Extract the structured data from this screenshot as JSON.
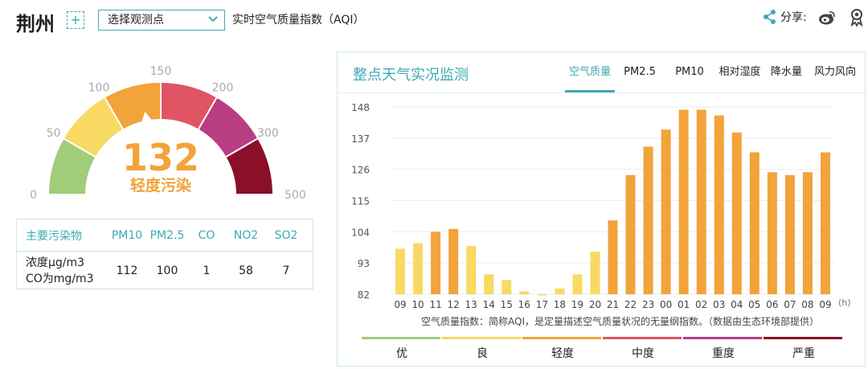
{
  "header": {
    "city": "荆州",
    "add_label": "+",
    "station_select": "选择观测点",
    "aqi_title": "实时空气质量指数（AQI）",
    "share_label": "分享:"
  },
  "gauge": {
    "value": "132",
    "level": "轻度污染",
    "ticks": [
      "0",
      "50",
      "100",
      "150",
      "200",
      "300",
      "500"
    ],
    "segment_colors": [
      "#9fcd7a",
      "#f7d964",
      "#f2a33a",
      "#e05563",
      "#b83d82",
      "#8b0f28"
    ],
    "value_color": "#f2a33a",
    "needle_value": 132
  },
  "pollutants": {
    "header": [
      "主要污染物",
      "PM10",
      "PM2.5",
      "CO",
      "NO2",
      "SO2"
    ],
    "row_label_line1": "浓度μg/m3",
    "row_label_line2": "CO为mg/m3",
    "values": [
      "112",
      "100",
      "1",
      "58",
      "7"
    ]
  },
  "panel": {
    "title": "整点天气实况监测",
    "tabs": [
      "空气质量",
      "PM2.5",
      "PM10",
      "相对湿度",
      "降水量",
      "风力风向"
    ],
    "active_tab": 0,
    "note": "空气质量指数：简称AQI，是定量描述空气质量状况的无量纲指数。（数据由生态环境部提供）"
  },
  "legend": {
    "items": [
      "优",
      "良",
      "轻度",
      "中度",
      "重度",
      "严重"
    ],
    "colors": [
      "#9fcd7a",
      "#f7d964",
      "#f2a33a",
      "#e05563",
      "#b83d82",
      "#8b0f28"
    ]
  },
  "chart_data": {
    "type": "bar",
    "xlabel": "(h)",
    "ylabel": "",
    "ylim": [
      82,
      148
    ],
    "yticks": [
      82,
      93,
      104,
      115,
      126,
      137,
      148
    ],
    "categories": [
      "09",
      "10",
      "11",
      "12",
      "13",
      "14",
      "15",
      "16",
      "17",
      "18",
      "19",
      "20",
      "21",
      "22",
      "23",
      "00",
      "01",
      "02",
      "03",
      "04",
      "05",
      "06",
      "07",
      "08",
      "09"
    ],
    "values": [
      98,
      100,
      104,
      105,
      99,
      89,
      87,
      83,
      82,
      84,
      89,
      97,
      108,
      124,
      134,
      140,
      147,
      147,
      145,
      139,
      132,
      125,
      124,
      125,
      132
    ],
    "grid": true,
    "colors": {
      "good": "#f7d964",
      "light": "#f2a33a"
    }
  }
}
